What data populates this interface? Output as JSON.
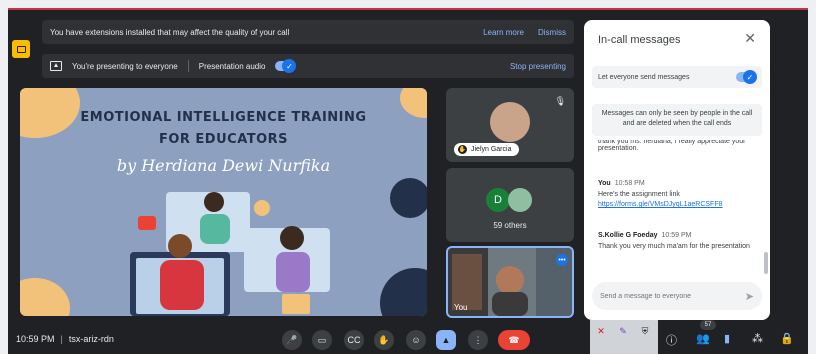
{
  "banner_extensions": {
    "text": "You have extensions installed that may affect the quality of your call",
    "learn_more": "Learn more",
    "dismiss": "Dismiss"
  },
  "banner_presenting": {
    "text": "You're presenting to everyone",
    "audio_label": "Presentation audio",
    "stop": "Stop presenting"
  },
  "slide": {
    "title_line1": "EMOTIONAL INTELLIGENCE TRAINING",
    "title_line2": "FOR EDUCATORS",
    "byline": "by Herdiana Dewi Nurfika"
  },
  "tiles": {
    "participant_name": "Jielyn Garcia",
    "others_initial": "D",
    "others_count": "59 others",
    "self_label": "You"
  },
  "chat": {
    "title": "In-call messages",
    "setting_label": "Let everyone send messages",
    "notice": "Messages can only be seen by people in the call and are deleted when the call ends",
    "messages": [
      {
        "text": "thank you ms. herdiana, I really appreciate your presentation."
      },
      {
        "sender": "You",
        "time": "10:58 PM",
        "text": "Here's the assignment link",
        "link": "https://forms.gle/VMsDJyqL1aeRCSFF8"
      },
      {
        "sender": "S.Kollie G Foeday",
        "time": "10:59 PM",
        "text": "Thank you very much ma'am for the presentation"
      }
    ],
    "compose_placeholder": "Send a message to everyone"
  },
  "bottom": {
    "time": "10:59 PM",
    "meeting_code": "tsx-ariz-rdn",
    "people_count": "57"
  },
  "colors": {
    "background": "#202124",
    "accent": "#8ab4f8",
    "end_call": "#ea4335",
    "warning": "#fbbc04"
  }
}
